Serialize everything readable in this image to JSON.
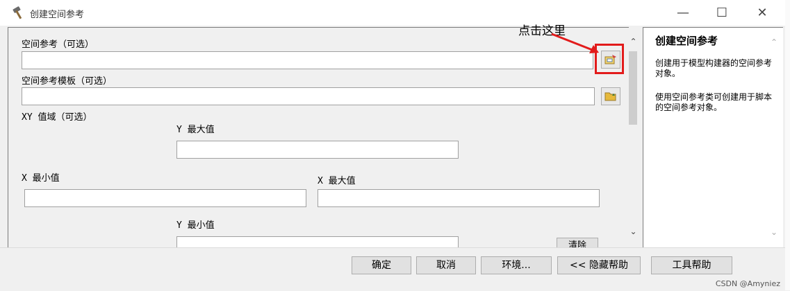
{
  "window": {
    "title": "创建空间参考",
    "minimize_icon": "minimize-icon",
    "maximize_icon": "maximize-icon",
    "close_icon": "close-icon"
  },
  "form": {
    "spatial_ref_label": "空间参考（可选）",
    "spatial_ref_value": "",
    "spatial_ref_template_label": "空间参考模板（可选）",
    "spatial_ref_template_value": "",
    "xy_domain_label": "XY 值域（可选）",
    "y_max_label": "Y 最大值",
    "y_max_value": "",
    "x_min_label": "X 最小值",
    "x_min_value": "",
    "x_max_label": "X 最大值",
    "x_max_value": "",
    "y_min_label": "Y 最小值",
    "y_min_value": "",
    "clear_button": "清除"
  },
  "annotation": {
    "text": "点击这里",
    "color": "#e21b1b"
  },
  "help": {
    "title": "创建空间参考",
    "para1": "创建用于模型构建器的空间参考对象。",
    "para2": "使用空间参考类可创建用于脚本的空间参考对象。"
  },
  "buttons": {
    "ok": "确定",
    "cancel": "取消",
    "environments": "环境...",
    "hide_help": "<< 隐藏帮助",
    "tool_help": "工具帮助"
  },
  "watermark": "CSDN @Amyniez"
}
